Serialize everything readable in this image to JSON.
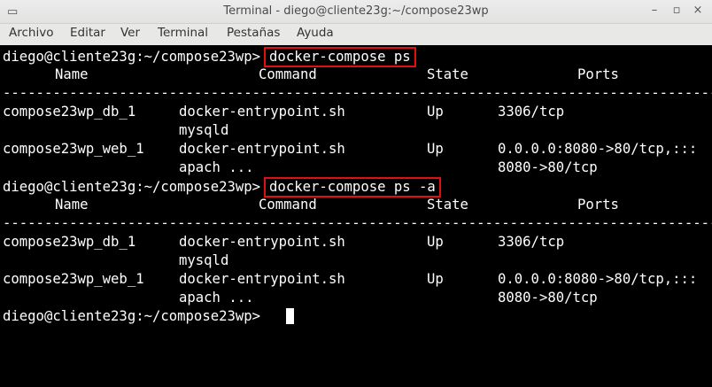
{
  "window": {
    "title": "Terminal - diego@cliente23g:~/compose23wp",
    "icon": "terminal-icon",
    "minimize": "–",
    "maximize": "▫",
    "close": "×"
  },
  "menu": [
    "Archivo",
    "Editar",
    "Ver",
    "Terminal",
    "Pestañas",
    "Ayuda"
  ],
  "terminal": {
    "prompt": "diego@cliente23g:~/compose23wp>",
    "commands": [
      "docker-compose ps",
      "docker-compose ps -a"
    ],
    "headers": [
      "Name",
      "Command",
      "State",
      "Ports"
    ],
    "separator": "-----------------------------------------------------------------------------------------------------",
    "rows": [
      {
        "name": "compose23wp_db_1",
        "command": [
          "docker-entrypoint.sh",
          "mysqld"
        ],
        "state": "Up",
        "ports": [
          "3306/tcp"
        ]
      },
      {
        "name": "compose23wp_web_1",
        "command": [
          "docker-entrypoint.sh",
          "apach ..."
        ],
        "state": "Up",
        "ports": [
          "0.0.0.0:8080->80/tcp,:::",
          "8080->80/tcp"
        ]
      }
    ]
  }
}
